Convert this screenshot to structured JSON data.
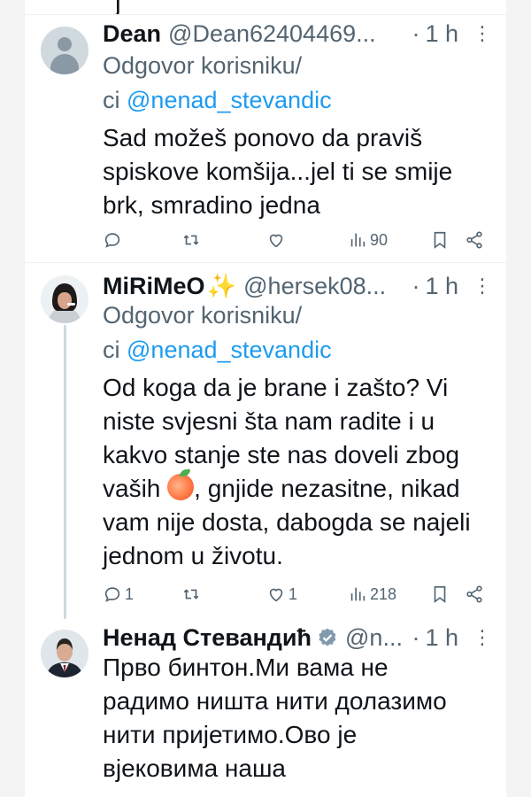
{
  "reply_prefix": "Odgovor korisniku/",
  "reply_prefix_cont": "ci",
  "top_fragment": "j",
  "tweets": [
    {
      "name": "Dean",
      "handle": "@Dean62404469...",
      "time": "1 h",
      "dot": "·",
      "mention": "@nenad_stevandic",
      "text": "Sad možeš ponovo da praviš spiskove komšija...jel ti se smije brk, smradino jedna",
      "stats": {
        "replies": "",
        "retweets": "",
        "likes": "",
        "views": "90"
      }
    },
    {
      "name": "MiRiMeO",
      "name_emoji": "✨",
      "handle": "@hersek08...",
      "time": "1 h",
      "dot": "·",
      "mention": "@nenad_stevandic",
      "text_part1": "Od koga da je brane i zašto? Vi niste svjesni šta nam radite i u kakvo stanje ste nas doveli zbog vaših",
      "text_part2": ", gnjide nezasitne, nikad vam nije dosta, dabogda se najeli jednom u životu.",
      "stats": {
        "replies": "1",
        "retweets": "",
        "likes": "1",
        "views": "218"
      }
    },
    {
      "name": "Ненад Стевандић",
      "handle": "@n...",
      "time": "1 h",
      "dot": "·",
      "text": "Прво бинтон.Ми вама не радимо ништа нити долазимо нити пријетимо.Ово је вјековима наша"
    }
  ],
  "colors": {
    "link": "#1d9bf0",
    "muted": "#536471",
    "text": "#0f1419",
    "verified": "#829aab"
  }
}
